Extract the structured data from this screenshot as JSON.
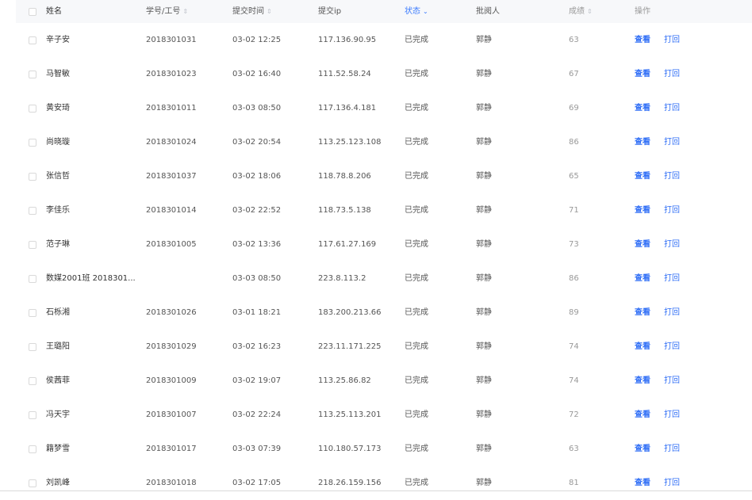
{
  "table": {
    "headers": {
      "name": "姓名",
      "id": "学号/工号",
      "time": "提交时间",
      "ip": "提交ip",
      "status": "状态",
      "grader": "批阅人",
      "score": "成绩",
      "actions": "操作"
    },
    "action_labels": {
      "view": "查看",
      "return": "打回"
    },
    "rows": [
      {
        "name": "辛子安",
        "id": "2018301031",
        "time": "03-02 12:25",
        "ip": "117.136.90.95",
        "status": "已完成",
        "grader": "郭静",
        "score": "63"
      },
      {
        "name": "马智敏",
        "id": "2018301023",
        "time": "03-02 16:40",
        "ip": "111.52.58.24",
        "status": "已完成",
        "grader": "郭静",
        "score": "67"
      },
      {
        "name": "黄安琦",
        "id": "2018301011",
        "time": "03-03 08:50",
        "ip": "117.136.4.181",
        "status": "已完成",
        "grader": "郭静",
        "score": "69"
      },
      {
        "name": "尚晓璇",
        "id": "2018301024",
        "time": "03-02 20:54",
        "ip": "113.25.123.108",
        "status": "已完成",
        "grader": "郭静",
        "score": "86"
      },
      {
        "name": "张信哲",
        "id": "2018301037",
        "time": "03-02 18:06",
        "ip": "118.78.8.206",
        "status": "已完成",
        "grader": "郭静",
        "score": "65"
      },
      {
        "name": "李佳乐",
        "id": "2018301014",
        "time": "03-02 22:52",
        "ip": "118.73.5.138",
        "status": "已完成",
        "grader": "郭静",
        "score": "71"
      },
      {
        "name": "范子琳",
        "id": "2018301005",
        "time": "03-02 13:36",
        "ip": "117.61.27.169",
        "status": "已完成",
        "grader": "郭静",
        "score": "73"
      },
      {
        "name": "数媒2001班 2018301...",
        "id": "",
        "time": "03-03 08:50",
        "ip": "223.8.113.2",
        "status": "已完成",
        "grader": "郭静",
        "score": "86"
      },
      {
        "name": "石栎湘",
        "id": "2018301026",
        "time": "03-01 18:21",
        "ip": "183.200.213.66",
        "status": "已完成",
        "grader": "郭静",
        "score": "89"
      },
      {
        "name": "王璐阳",
        "id": "2018301029",
        "time": "03-02 16:23",
        "ip": "223.11.171.225",
        "status": "已完成",
        "grader": "郭静",
        "score": "74"
      },
      {
        "name": "侯茜菲",
        "id": "2018301009",
        "time": "03-02 19:07",
        "ip": "113.25.86.82",
        "status": "已完成",
        "grader": "郭静",
        "score": "74"
      },
      {
        "name": "冯天宇",
        "id": "2018301007",
        "time": "03-02 22:24",
        "ip": "113.25.113.201",
        "status": "已完成",
        "grader": "郭静",
        "score": "72"
      },
      {
        "name": "籍梦雪",
        "id": "2018301017",
        "time": "03-03 07:39",
        "ip": "110.180.57.173",
        "status": "已完成",
        "grader": "郭静",
        "score": "63"
      },
      {
        "name": "刘凯峰",
        "id": "2018301018",
        "time": "03-02 17:05",
        "ip": "218.26.159.156",
        "status": "已完成",
        "grader": "郭静",
        "score": "81"
      }
    ]
  }
}
